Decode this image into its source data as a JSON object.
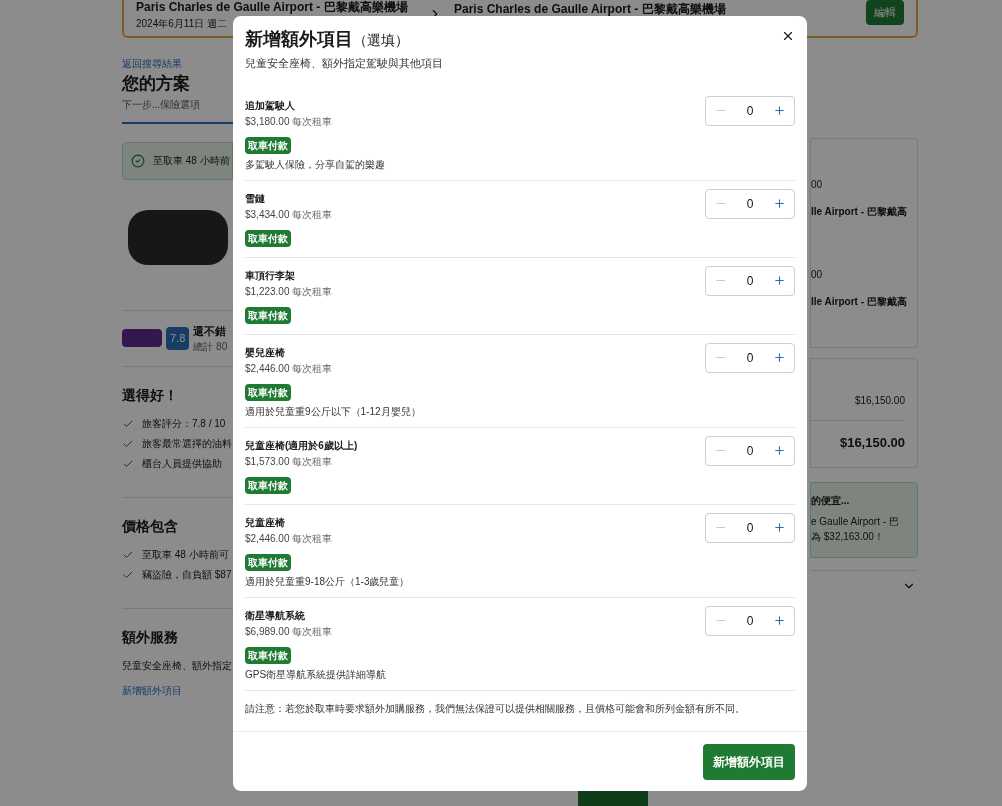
{
  "background": {
    "trip": {
      "pickup": "Paris Charles de Gaulle Airport - 巴黎戴高樂機場",
      "pickup_date": "2024年6月11日 週二",
      "dropoff": "Paris Charles de Gaulle Airport - 巴黎戴高樂機場",
      "edit": "編輯"
    },
    "left": {
      "back_link": "返回搜尋結果",
      "title": "您的方案",
      "next_step": "下一步...保險選項",
      "notice": "至取車 48 小時前",
      "rating": "7.8",
      "rating_label": "還不錯",
      "rating_count": "總計 80",
      "good_title": "選得好！",
      "good_points": [
        "旅客評分：7.8 / 10",
        "旅客最常選擇的油料",
        "櫃台人員提供協助"
      ],
      "included_title": "價格包含",
      "included_points": [
        "至取車 48 小時前可",
        "竊盜險，自負額 $87"
      ],
      "extras_title": "額外服務",
      "extras_text": "兒童安全座椅、額外指定",
      "extras_link": "新增額外項目"
    },
    "right": {
      "trip_lines": [
        "00",
        "lle Airport - 巴黎戴高",
        "00",
        "lle Airport - 巴黎戴高"
      ],
      "subtotal": "$16,150.00",
      "total": "$16,150.00",
      "deal_title": "的便宜...",
      "deal_lines": [
        "e Gaulle Airport - 巴",
        "為 $32,163.00！"
      ]
    }
  },
  "modal": {
    "title": "新增額外項目",
    "title_note": "（選填）",
    "subtitle": "兒童安全座椅、額外指定駕駛與其他項目",
    "items": [
      {
        "name": "追加駕駛人",
        "price": "$3,180.00",
        "unit": "每次租車",
        "badge": "取車付款",
        "description": "多駕駛人保險，分享自駕的樂趣",
        "quantity": "0",
        "decrease_disabled": true
      },
      {
        "name": "雪鏈",
        "price": "$3,434.00",
        "unit": "每次租車",
        "badge": "取車付款",
        "quantity": "0",
        "decrease_disabled": true
      },
      {
        "name": "車頂行李架",
        "price": "$1,223.00",
        "unit": "每次租車",
        "badge": "取車付款",
        "quantity": "0",
        "decrease_disabled": true
      },
      {
        "name": "嬰兒座椅",
        "price": "$2,446.00",
        "unit": "每次租車",
        "badge": "取車付款",
        "description": "適用於兒童重9公斤以下（1-12月嬰兒）",
        "quantity": "0",
        "decrease_disabled": true
      },
      {
        "name": "兒童座椅(適用於6歲以上)",
        "price": "$1,573.00",
        "unit": "每次租車",
        "badge": "取車付款",
        "quantity": "0",
        "decrease_disabled": true
      },
      {
        "name": "兒童座椅",
        "price": "$2,446.00",
        "unit": "每次租車",
        "badge": "取車付款",
        "description": "適用於兒童重9-18公斤（1-3歲兒童）",
        "quantity": "0",
        "decrease_disabled": true
      },
      {
        "name": "衛星導航系統",
        "price": "$6,989.00",
        "unit": "每次租車",
        "badge": "取車付款",
        "description": "GPS衛星導航系統提供詳細導航",
        "quantity": "0",
        "decrease_disabled": true
      }
    ],
    "note": "請注意：若您於取車時要求額外加購服務，我們無法保證可以提供相關服務，且價格可能會和所列金額有所不同。",
    "submit": "新增額外項目"
  }
}
